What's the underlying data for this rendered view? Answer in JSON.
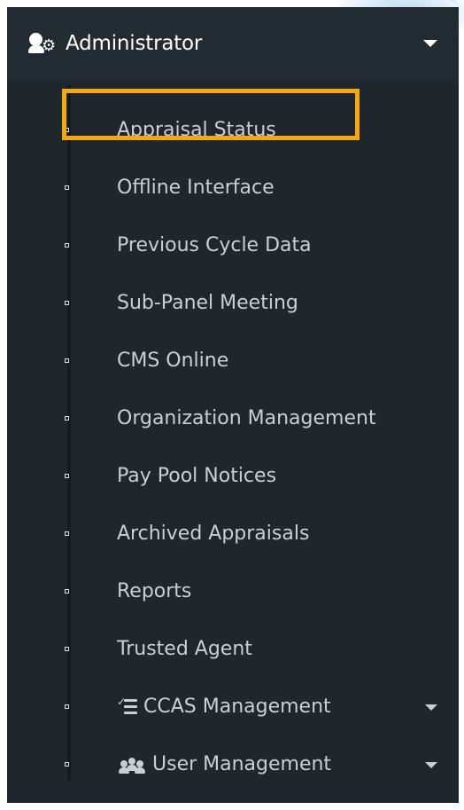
{
  "admin": {
    "title": "Administrator",
    "icon": "user-gear-icon",
    "caret_icon": "chevron-down-icon"
  },
  "menu": {
    "items": [
      {
        "label": "Appraisal Status",
        "highlighted": true
      },
      {
        "label": "Offline Interface"
      },
      {
        "label": "Previous Cycle Data"
      },
      {
        "label": "Sub-Panel Meeting"
      },
      {
        "label": "CMS Online"
      },
      {
        "label": "Organization Management"
      },
      {
        "label": "Pay Pool Notices"
      },
      {
        "label": "Archived Appraisals"
      },
      {
        "label": "Reports"
      },
      {
        "label": "Trusted Agent"
      },
      {
        "label": "CCAS Management",
        "icon": "checklist-icon",
        "submenu": true
      },
      {
        "label": "User Management",
        "icon": "users-icon",
        "submenu": true
      }
    ]
  },
  "colors": {
    "sidebar_background": "#222b32",
    "menu_background": "#1f272d",
    "highlight_border": "#f2a90d",
    "text": "#c8d0d6",
    "header_text": "#ffffff"
  }
}
